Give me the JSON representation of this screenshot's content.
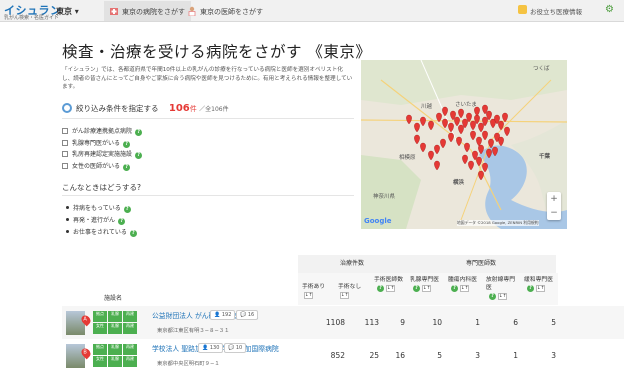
{
  "nav": {
    "logo": "イシュラン",
    "logo_sub": "乳がん検索・名医ガイド",
    "region": "東京",
    "tabs": [
      {
        "label": "東京の病院をさがす",
        "icon": "hospital-icon"
      },
      {
        "label": "東京の医師をさがす",
        "icon": "doctor-icon"
      }
    ],
    "useful": "お役立ち医療情報",
    "settings_icon": "gear-icon"
  },
  "page": {
    "title": "検査・治療を受ける病院をさがす 《東京》",
    "intro": "「イシュラン」では、各都道府県で年間10件以上の乳がんの診療を行なっている病院と医師を選別オペリスト化し、読者の皆さんにとってご自身やご家族に合う病院や医師を見つけるために。有用と考えられる情報を整理しています。"
  },
  "filter": {
    "label": "絞り込み条件を指定する",
    "count": "106",
    "count_suffix": "件",
    "total": "／全106件",
    "options": [
      "がん診療連携拠点病院",
      "乳腺専門医がいる",
      "乳房再建認定実施施設",
      "女性の医師がいる"
    ]
  },
  "when": {
    "title": "こんなときはどうする?",
    "items": [
      "持病をもっている",
      "再発・進行がん",
      "お仕事をされている"
    ]
  },
  "map": {
    "labels": [
      "つくば",
      "さいたま",
      "千葉",
      "相模原",
      "横浜",
      "神奈川県",
      "川越"
    ],
    "credit": "地図データ ©2018 Google, ZENRIN  利用規約",
    "google": "Google",
    "zoom_in": "+",
    "zoom_out": "−"
  },
  "table": {
    "group_treatment": "治療件数",
    "group_specialist": "専門医師数",
    "name_header": "施設名",
    "columns": [
      {
        "label": "手術あり",
        "help": false
      },
      {
        "label": "手術なし",
        "help": false
      },
      {
        "label": "手術医師数",
        "help": true
      },
      {
        "label": "乳腺専門医",
        "help": true
      },
      {
        "label": "腫瘍内科医",
        "help": true
      },
      {
        "label": "放射線専門医",
        "help": true
      },
      {
        "label": "緩和専門医",
        "help": true
      }
    ],
    "sort_label": "↓↑",
    "rows": [
      {
        "marker": "A",
        "badges": [
          "拠点",
          "乳腺",
          "再建",
          "女性",
          "乳腺",
          "再建"
        ],
        "name": "公益財団法人 がん研究会 有明病院",
        "likes": "192",
        "comments": "16",
        "address": "東京都江東区有明３−８−３１",
        "values": [
          "1108",
          "113",
          "9",
          "10",
          "1",
          "6",
          "5"
        ]
      },
      {
        "marker": "B",
        "badges": [
          "拠点",
          "乳腺",
          "再建",
          "女性",
          "乳腺",
          "再建"
        ],
        "name": "学校法人 聖路加国際大学 聖路加国際病院",
        "likes": "130",
        "comments": "10",
        "address": "東京都中央区明石町９−１",
        "values": [
          "852",
          "25",
          "16",
          "5",
          "3",
          "1",
          "3"
        ]
      }
    ]
  },
  "colors": {
    "brand": "#1e73b8",
    "count": "#e53935",
    "badge": "#4caf50",
    "marker": "#e53935"
  }
}
